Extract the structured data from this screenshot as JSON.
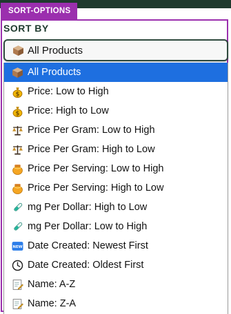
{
  "tag_label": "SORT-OPTIONS",
  "sort_label": "SORT BY",
  "select": {
    "value": "All Products",
    "icon": "box-icon"
  },
  "options": [
    {
      "label": "All Products",
      "icon": "box-icon",
      "selected": true
    },
    {
      "label": "Price: Low to High",
      "icon": "money-bag-icon"
    },
    {
      "label": "Price: High to Low",
      "icon": "money-bag-icon"
    },
    {
      "label": "Price Per Gram: Low to High",
      "icon": "scales-icon"
    },
    {
      "label": "Price Per Gram: High to Low",
      "icon": "scales-icon"
    },
    {
      "label": "Price Per Serving: Low to High",
      "icon": "honey-pot-icon"
    },
    {
      "label": "Price Per Serving: High to Low",
      "icon": "honey-pot-icon"
    },
    {
      "label": "mg Per Dollar: High to Low",
      "icon": "test-tube-icon"
    },
    {
      "label": "mg Per Dollar: Low to High",
      "icon": "test-tube-icon"
    },
    {
      "label": "Date Created: Newest First",
      "icon": "new-badge-icon"
    },
    {
      "label": "Date Created: Oldest First",
      "icon": "clock-icon"
    },
    {
      "label": "Name: A-Z",
      "icon": "memo-icon"
    },
    {
      "label": "Name: Z-A",
      "icon": "memo-icon"
    }
  ],
  "colors": {
    "accent_purple": "#9b2fae",
    "selected_blue": "#1e6fe0",
    "dark_green": "#1f3a2e"
  }
}
